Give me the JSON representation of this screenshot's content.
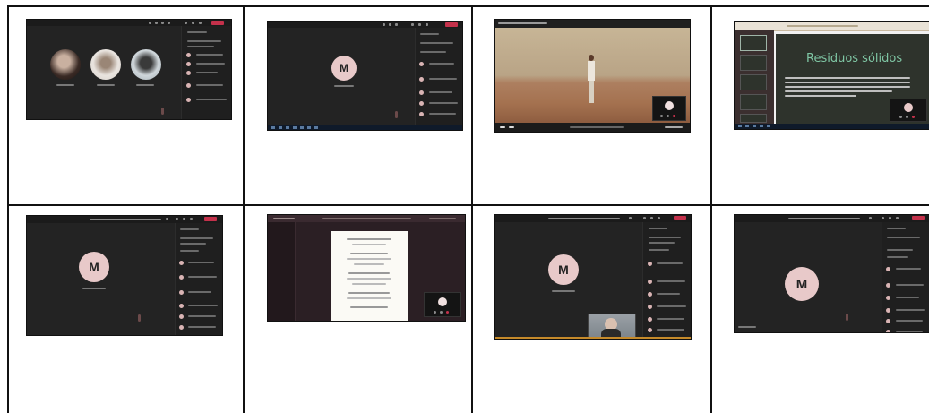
{
  "grid": {
    "cells": [
      {
        "type": "teams-circles",
        "labels": [
          "",
          "",
          ""
        ]
      },
      {
        "type": "teams-avatar",
        "avatar_letter": "M"
      },
      {
        "type": "video-desert"
      },
      {
        "type": "slides",
        "slide_title": "Residuos sólidos"
      },
      {
        "type": "teams-avatar",
        "avatar_letter": "M"
      },
      {
        "type": "document"
      },
      {
        "type": "teams-avatar-webcam",
        "avatar_letter": "M"
      },
      {
        "type": "teams-avatar",
        "avatar_letter": "M"
      }
    ]
  },
  "colors": {
    "teams_bg": "#232323",
    "avatar_bg": "#e8c9c9",
    "leave_red": "#c4314b",
    "slide_bg": "#2e332c",
    "slide_title_color": "#7fc6a4",
    "desert_sky": "#b9a486",
    "desert_ground": "#a8795a"
  }
}
